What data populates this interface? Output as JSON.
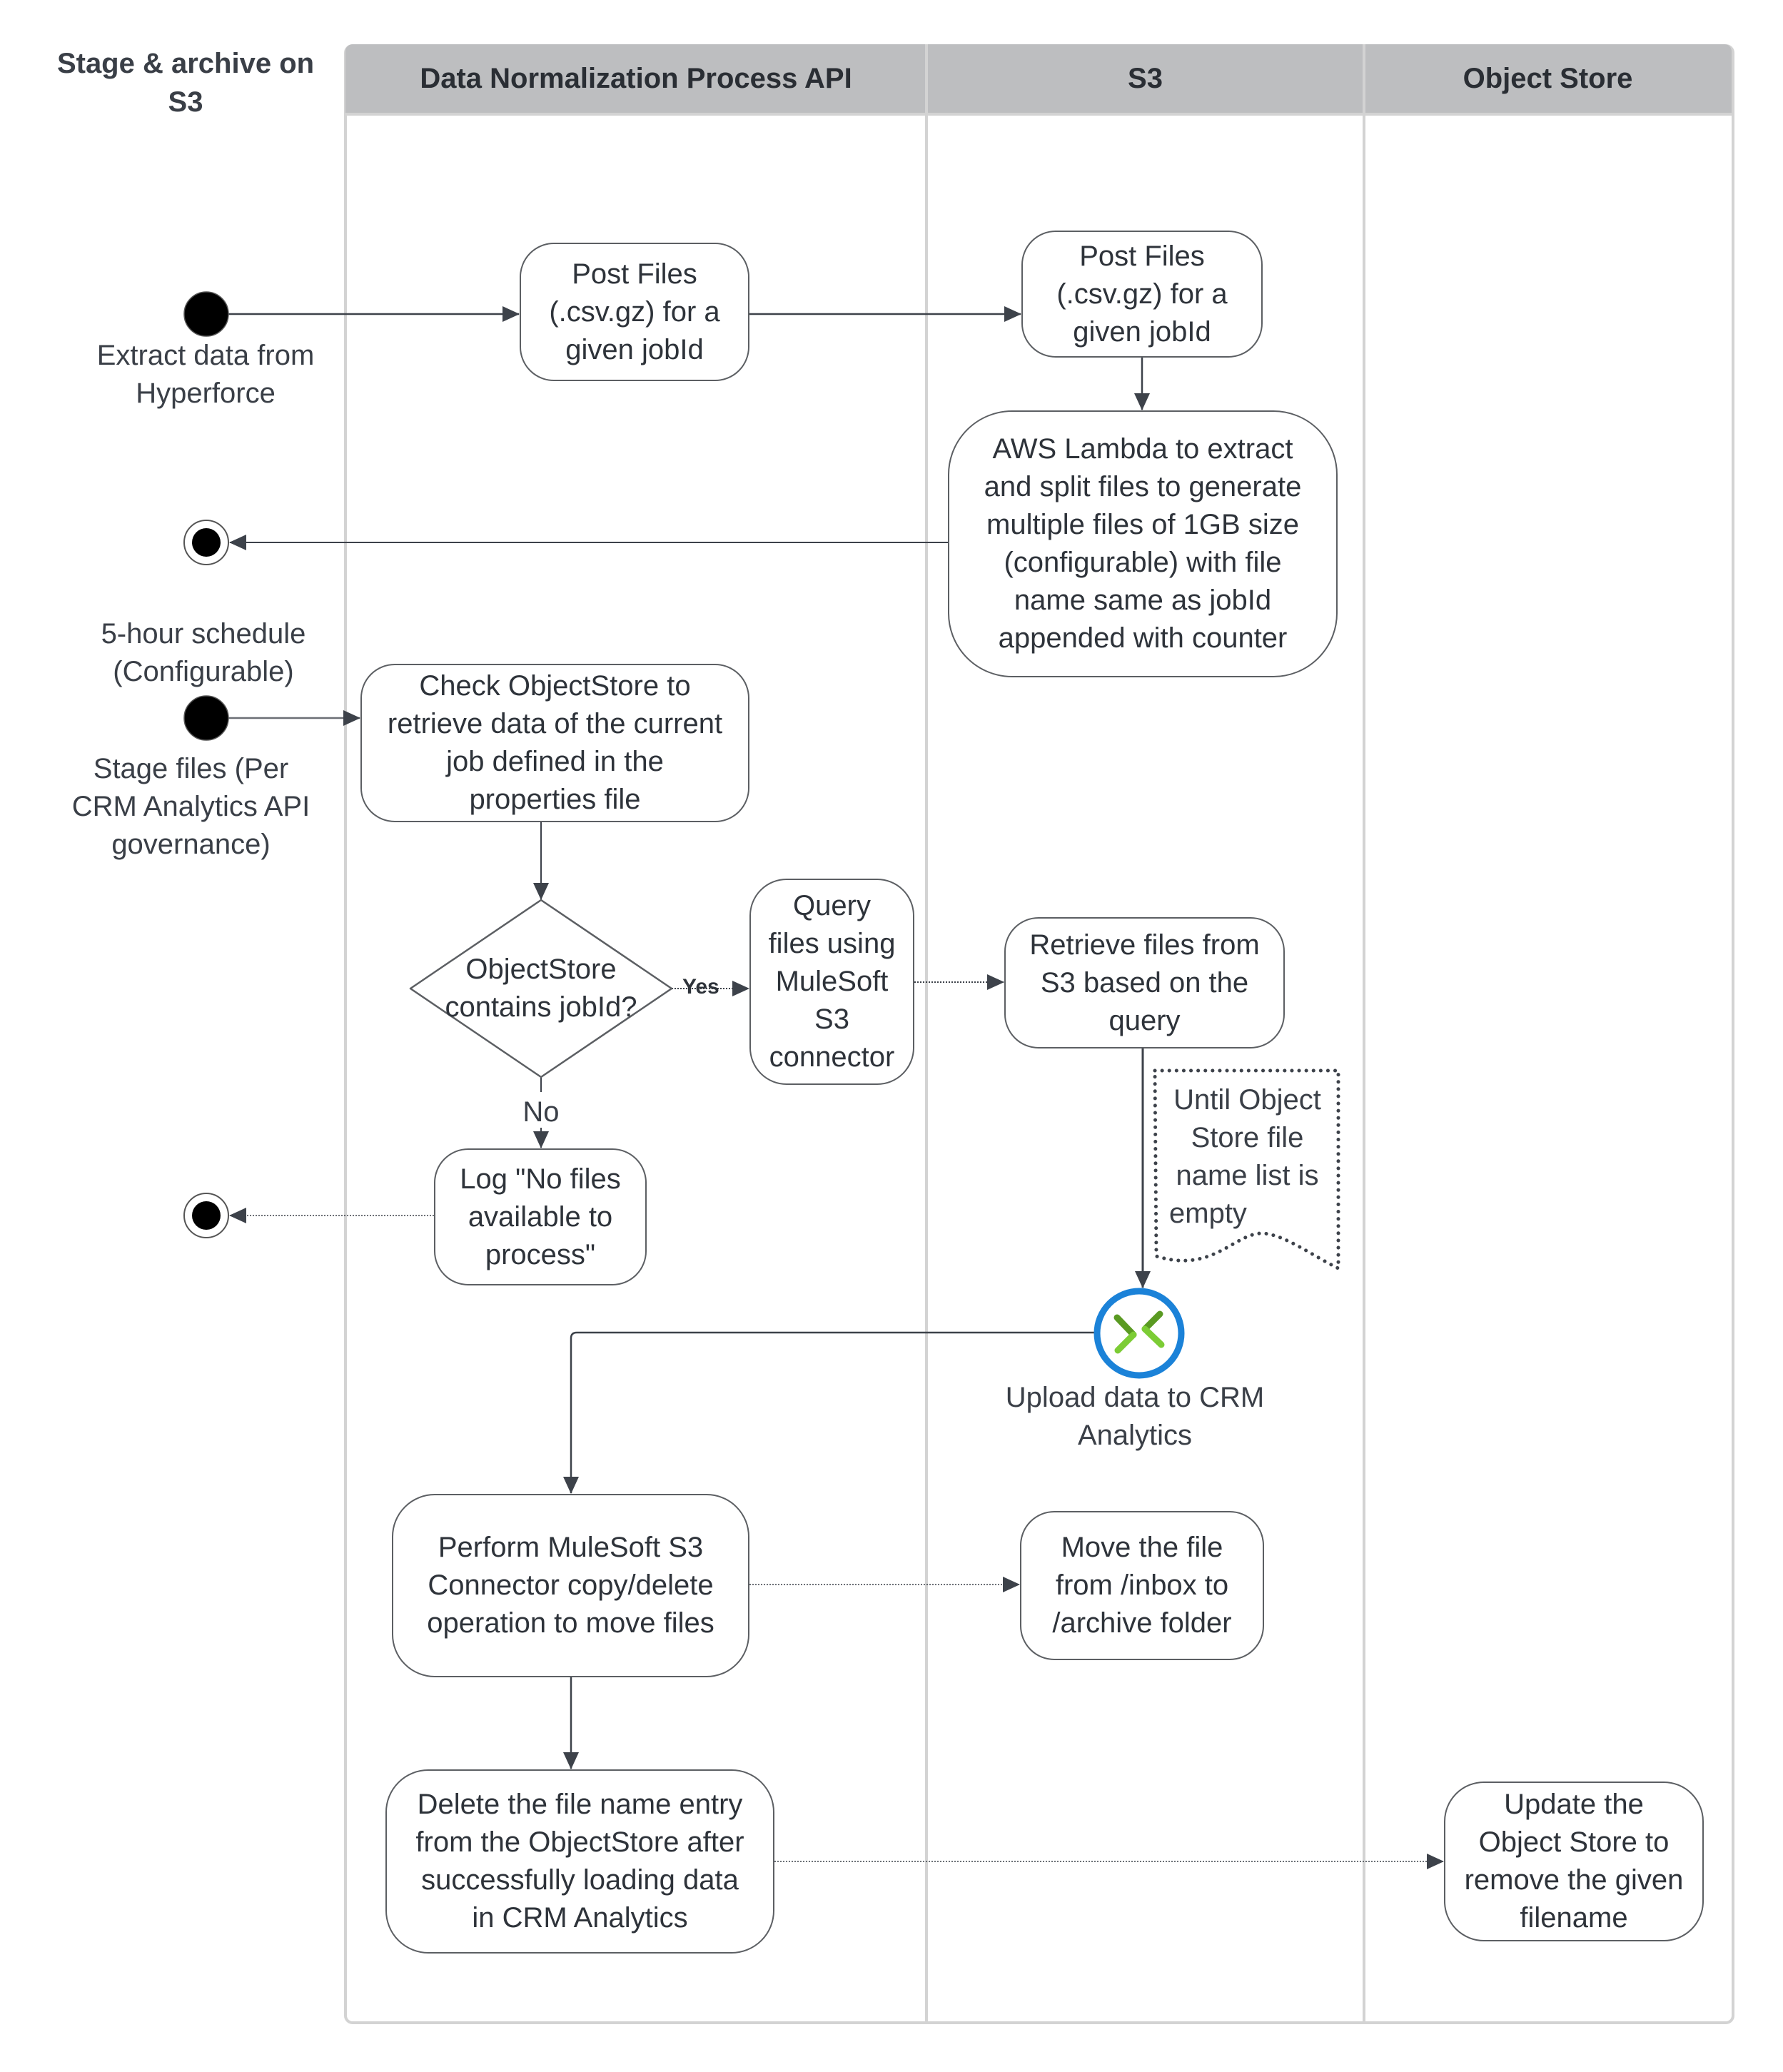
{
  "diagram_title": [
    "Stage & archive on",
    "S3"
  ],
  "lanes": [
    {
      "label": "Data Normalization Process API"
    },
    {
      "label": "S3"
    },
    {
      "label": "Object Store"
    }
  ],
  "colors": {
    "lane_header": "#bdbec0",
    "lane_border": "#d3d3d3",
    "text": "#2e333a",
    "connector": "#3d424a",
    "upload_ring": "#1b82d8",
    "upload_icon_light": "#7ccc35",
    "upload_icon_dark": "#5a9a22"
  },
  "start_labels": {
    "extract": [
      "Extract data from",
      "Hyperforce"
    ],
    "schedule": [
      "5-hour schedule",
      "(Configurable)"
    ],
    "stage": [
      "Stage files (Per",
      "CRM Analytics API",
      "governance)"
    ]
  },
  "nodes": {
    "post_files_api": {
      "lines": [
        "Post Files",
        "(.csv.gz) for a",
        "given jobId"
      ]
    },
    "post_files_s3": {
      "lines": [
        "Post Files",
        "(.csv.gz) for a",
        "given jobId"
      ]
    },
    "aws_lambda": {
      "lines": [
        "AWS Lambda to extract",
        "and split files to generate",
        "multiple files of 1GB size",
        "(configurable) with file",
        "name same as jobId",
        "appended with counter"
      ]
    },
    "check_objectstore": {
      "lines": [
        "Check ObjectStore to",
        "retrieve data of the current",
        "job defined in the",
        "properties file"
      ]
    },
    "decision": {
      "lines": [
        "ObjectStore",
        "contains jobId?"
      ]
    },
    "query_files": {
      "lines": [
        "Query",
        "files using",
        "MuleSoft",
        "S3",
        "connector"
      ]
    },
    "retrieve_files": {
      "lines": [
        "Retrieve files from",
        "S3 based on the",
        "query"
      ]
    },
    "log_no_files": {
      "lines": [
        "Log \"No files",
        "available to",
        "process\""
      ]
    },
    "loop_note": {
      "lines": [
        "Until Object",
        "Store file",
        "name list is",
        "empty"
      ]
    },
    "upload": {
      "lines": [
        "Upload data to CRM",
        "Analytics"
      ]
    },
    "perform_copy_delete": {
      "lines": [
        "Perform MuleSoft S3",
        "Connector copy/delete",
        "operation to move files"
      ]
    },
    "move_file": {
      "lines": [
        "Move the file",
        "from /inbox to",
        "/archive folder"
      ]
    },
    "delete_entry": {
      "lines": [
        "Delete the file name entry",
        "from the ObjectStore after",
        "successfully loading data",
        "in CRM Analytics"
      ]
    },
    "update_objectstore": {
      "lines": [
        "Update the",
        "Object Store to",
        "remove the given",
        "filename"
      ]
    }
  },
  "edge_labels": {
    "yes": "Yes",
    "no": "No"
  }
}
